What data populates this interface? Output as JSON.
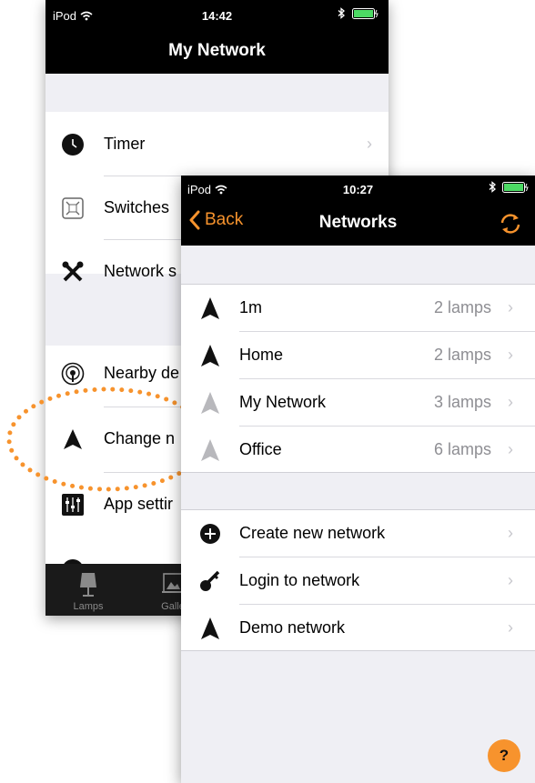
{
  "back_screen": {
    "status": {
      "carrier": "iPod",
      "time": "14:42"
    },
    "title": "My Network",
    "rows_group1": [
      {
        "label": "Timer",
        "icon": "clock-icon"
      },
      {
        "label": "Switches",
        "icon": "switch-icon"
      },
      {
        "label": "Network s",
        "icon": "tools-icon"
      }
    ],
    "rows_group2": [
      {
        "label": "Nearby de",
        "icon": "broadcast-icon"
      },
      {
        "label": "Change n",
        "icon": "network-arrow-icon"
      },
      {
        "label": "App settir",
        "icon": "sliders-icon"
      }
    ],
    "tabs": [
      {
        "label": "Lamps",
        "icon": "lamp-icon"
      },
      {
        "label": "Galle",
        "icon": "gallery-icon"
      }
    ]
  },
  "front_screen": {
    "status": {
      "carrier": "iPod",
      "time": "10:27"
    },
    "back_label": "Back",
    "title": "Networks",
    "networks": [
      {
        "name": "1m",
        "lamps": "2 lamps",
        "active": true
      },
      {
        "name": "Home",
        "lamps": "2 lamps",
        "active": true
      },
      {
        "name": "My Network",
        "lamps": "3 lamps",
        "active": false
      },
      {
        "name": "Office",
        "lamps": "6 lamps",
        "active": false
      }
    ],
    "actions": [
      {
        "label": "Create new network",
        "icon": "plus-circle-icon"
      },
      {
        "label": "Login to network",
        "icon": "key-icon"
      },
      {
        "label": "Demo network",
        "icon": "network-arrow-icon"
      }
    ],
    "help_label": "?"
  },
  "colors": {
    "accent": "#f7932d",
    "inactive_icon": "#b8b8bc",
    "nav_bg": "#000000"
  }
}
